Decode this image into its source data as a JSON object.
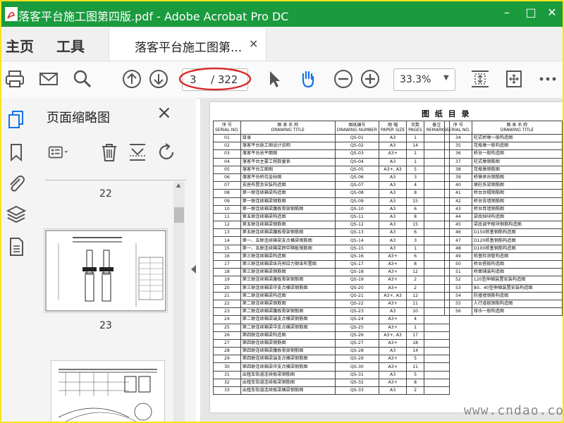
{
  "window": {
    "title": "落客平台施工图第四版.pdf - Adobe Acrobat Pro DC"
  },
  "nav": {
    "home": "主页",
    "tools": "工具"
  },
  "tab": {
    "label": "落客平台施工图第...",
    "close": "×"
  },
  "toolbar": {
    "page_current": "3",
    "page_total": "/ 322",
    "zoom": "33.3%"
  },
  "panel": {
    "title": "页面缩略图",
    "close": "×",
    "pages": [
      "22",
      "23"
    ]
  },
  "colors": {
    "titlebar": "#1a9b3e",
    "accent": "#1473e6",
    "annotation": "#d62b2b"
  },
  "document": {
    "title": "图 纸 目 录",
    "headers": {
      "seq": "序 号",
      "seq_en": "SERIAL NO.",
      "name": "图 表 名 称",
      "name_en": "DRAWING TITLE",
      "num": "图纸编号",
      "num_en": "DRAWING NUMBER",
      "size": "图 幅",
      "size_en": "PAPER SIZE",
      "pages": "页数",
      "pages_en": "PAGES",
      "remarks": "备注",
      "remarks_en": "REMARKS",
      "seq2": "序 号",
      "seq2_en": "SERIAL NO.",
      "name2": "图 表 名 称",
      "name2_en": "DRAWING TITLE"
    },
    "left_rows": [
      [
        "01",
        "目录",
        "QS-01",
        "A3",
        "1"
      ],
      [
        "02",
        "落客平台施工图设计说明",
        "QS-02",
        "A3",
        "14"
      ],
      [
        "03",
        "落客平台总平面图",
        "QS-03",
        "A3+",
        "1"
      ],
      [
        "04",
        "落客平台主要工程数量表",
        "QS-04",
        "A3",
        "1"
      ],
      [
        "05",
        "落客平台立面图",
        "QS-05",
        "A3+, A3",
        "5"
      ],
      [
        "06",
        "落客平台桥位坐标图",
        "QS-06",
        "A3",
        "3"
      ],
      [
        "07",
        "支座布置及安装构造图",
        "QS-07",
        "A3",
        "4"
      ],
      [
        "08",
        "第一联连续箱梁构造图",
        "QS-08",
        "A3",
        "8"
      ],
      [
        "09",
        "第一联连续箱梁钢筋图",
        "QS-09",
        "A3",
        "15"
      ],
      [
        "10",
        "第一联连续箱梁腹板骨架钢筋图",
        "QS-10",
        "A3",
        "6"
      ],
      [
        "11",
        "第五联连续箱梁构造图",
        "QS-11",
        "A3",
        "8"
      ],
      [
        "12",
        "第五联连续箱梁钢筋图",
        "QS-12",
        "A3",
        "15"
      ],
      [
        "13",
        "第五联连续箱梁腹板骨架钢筋图",
        "QS-13",
        "A3",
        "6"
      ],
      [
        "14",
        "第一、五联连续箱梁支点横梁钢筋图",
        "QS-14",
        "A3",
        "3"
      ],
      [
        "15",
        "第一、五联连续箱梁跨中隔板钢筋图",
        "QS-15",
        "A3",
        "1"
      ],
      [
        "16",
        "第三联连续箱梁构造图",
        "QS-16",
        "A3+",
        "6"
      ],
      [
        "17",
        "第三联连续箱梁纵向预应力钢束布置图",
        "QS-17",
        "A3+",
        "8"
      ],
      [
        "18",
        "第三联连续箱梁钢筋图",
        "QS-18",
        "A3+",
        "12"
      ],
      [
        "19",
        "第三联连续箱梁腹板骨架钢筋图",
        "QS-19",
        "A3+",
        "2"
      ],
      [
        "20",
        "第三联连续箱梁中支点横梁钢筋图",
        "QS-20",
        "A3+",
        "2"
      ],
      [
        "21",
        "第二联连续箱梁构造图",
        "QS-21",
        "A3+, A3",
        "12"
      ],
      [
        "22",
        "第二联连续箱梁钢筋图",
        "QS-22",
        "A3+",
        "11"
      ],
      [
        "23",
        "第二联连续箱梁腹板骨架钢筋图",
        "QS-23",
        "A3",
        "10"
      ],
      [
        "24",
        "第二联连续箱梁端支点横梁钢筋图",
        "QS-24",
        "A3+",
        "4"
      ],
      [
        "25",
        "第二联连续箱梁中支点横梁钢筋图",
        "QS-25",
        "A3+",
        "1"
      ],
      [
        "26",
        "第四联连续箱梁构造图",
        "QS-26",
        "A3+, A3",
        "17"
      ],
      [
        "27",
        "第四联连续箱梁钢筋图",
        "QS-27",
        "A3+",
        "18"
      ],
      [
        "28",
        "第四联连续箱梁腹板骨架钢筋图",
        "QS-28",
        "A3",
        "14"
      ],
      [
        "29",
        "第四联连续箱梁端支点横梁钢筋图",
        "QS-29",
        "A3+",
        "5"
      ],
      [
        "30",
        "第四联连续箱梁中支点横梁钢筋图",
        "QS-30",
        "A3+",
        "11"
      ],
      [
        "31",
        "出租车街道连续板梁钢筋图",
        "QS-31",
        "A3",
        "5"
      ],
      [
        "32",
        "出租车街道连续板梁钢筋图",
        "QS-32",
        "A3+",
        "8"
      ],
      [
        "33",
        "出租车街道连续板梁横梁钢筋图",
        "QS-33",
        "A3",
        "2"
      ]
    ],
    "right_rows": [
      [
        "34",
        "柱式桥墩一般构造图"
      ],
      [
        "35",
        "花瓶墩一般构造图"
      ],
      [
        "36",
        "桥台一般构造图"
      ],
      [
        "37",
        "柱式墩钢筋图"
      ],
      [
        "38",
        "花瓶墩钢筋图"
      ],
      [
        "39",
        "桥墩承台钢筋图"
      ],
      [
        "40",
        "墩柱系梁钢筋图"
      ],
      [
        "41",
        "桥台台帽钢筋图"
      ],
      [
        "42",
        "桥台背墙钢筋图"
      ],
      [
        "43",
        "桥台耳墙钢筋图"
      ],
      [
        "44",
        "梁底挡块构造图"
      ],
      [
        "45",
        "梁底调平楔块钢筋构造图"
      ],
      [
        "46",
        "D150桩基钢筋构造图"
      ],
      [
        "47",
        "D120桩基钢筋构造图"
      ],
      [
        "48",
        "D100桩基钢筋构造图"
      ],
      [
        "49",
        "桩基检测管构造图"
      ],
      [
        "50",
        "桥台搭板构造图"
      ],
      [
        "51",
        "桥面铺装构造图"
      ],
      [
        "52",
        "120型伸缩装置安装构造图"
      ],
      [
        "53",
        "80、40型伸缩装置安装构造图"
      ],
      [
        "54",
        "防撞墙钢筋构造图"
      ],
      [
        "55",
        "人行道板钢筋构造图"
      ],
      [
        "56",
        "排水一般构造图"
      ]
    ]
  },
  "watermark": "www.cndao.com"
}
